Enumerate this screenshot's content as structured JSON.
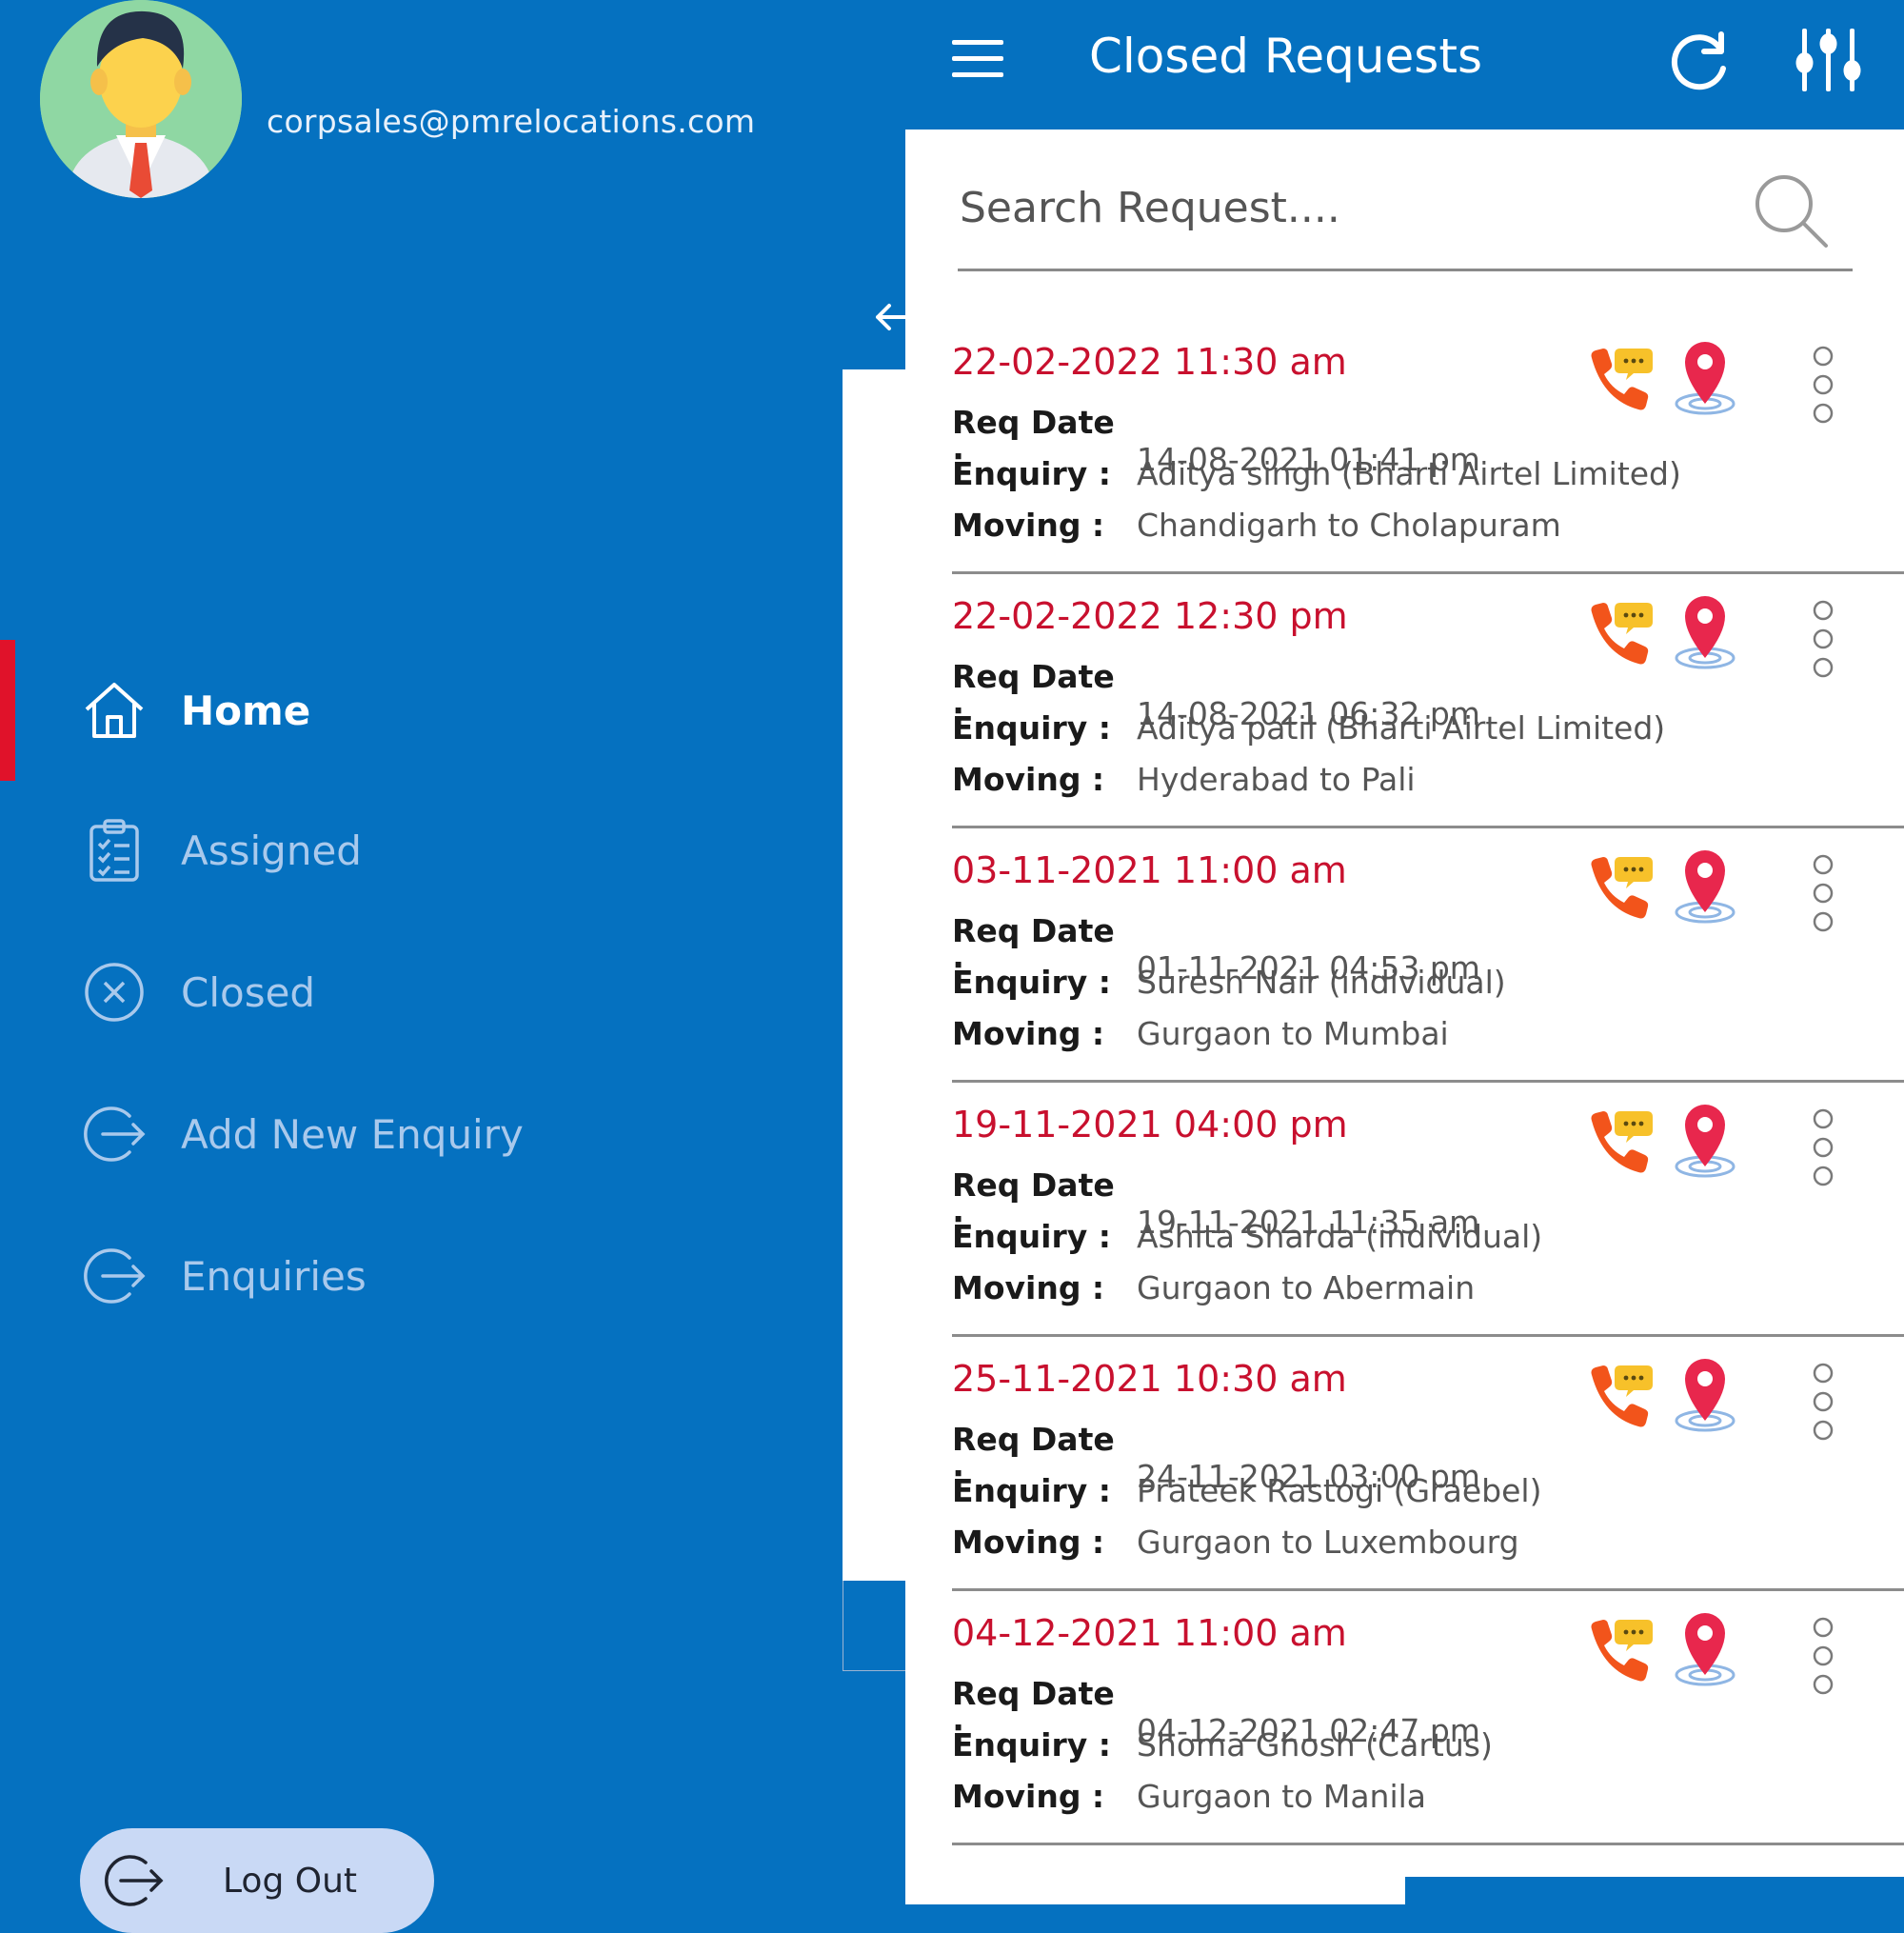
{
  "drawer": {
    "email": "corpsales@pmrelocations.com",
    "nav": [
      {
        "label": "Home",
        "icon": "home-icon",
        "active": true
      },
      {
        "label": "Assigned",
        "icon": "clipboard-icon",
        "active": false
      },
      {
        "label": "Closed",
        "icon": "close-circle-icon",
        "active": false
      },
      {
        "label": "Add New Enquiry",
        "icon": "login-arrow-icon",
        "active": false
      },
      {
        "label": "Enquiries",
        "icon": "login-arrow-icon",
        "active": false
      }
    ],
    "logout_label": "Log Out"
  },
  "header": {
    "title": "Closed Requests",
    "menu_icon": "hamburger-icon",
    "refresh_icon": "refresh-icon",
    "filter_icon": "filter-sliders-icon"
  },
  "search": {
    "placeholder": "Search Request...."
  },
  "labels": {
    "req_date": "Req Date :",
    "enquiry": "Enquiry :",
    "moving": "Moving :"
  },
  "requests": [
    {
      "date": "22-02-2022 11:30 am",
      "req_date": "14-08-2021 01:41 pm",
      "enquiry": "Aditya singh (Bharti Airtel Limited)",
      "moving": "Chandigarh to Cholapuram"
    },
    {
      "date": "22-02-2022 12:30 pm",
      "req_date": "14-08-2021 06:32 pm",
      "enquiry": "Aditya patil (Bharti Airtel Limited)",
      "moving": "Hyderabad to Pali"
    },
    {
      "date": "03-11-2021 11:00 am",
      "req_date": "01-11-2021 04:53 pm",
      "enquiry": "Suresh Nair (individual)",
      "moving": "Gurgaon to Mumbai"
    },
    {
      "date": "19-11-2021 04:00 pm",
      "req_date": "19-11-2021 11:35 am",
      "enquiry": "Ashita Sharda (individual)",
      "moving": "Gurgaon to Abermain"
    },
    {
      "date": "25-11-2021 10:30 am",
      "req_date": "24-11-2021 03:00 pm",
      "enquiry": "Prateek Rastogi (Graebel)",
      "moving": "Gurgaon to Luxembourg"
    },
    {
      "date": "04-12-2021 11:00 am",
      "req_date": "04-12-2021 02:47 pm",
      "enquiry": "Shoma  Ghosh  (Cartus)",
      "moving": "Gurgaon to Manila"
    }
  ],
  "colors": {
    "primary": "#0571c0",
    "date_red": "#c8102e",
    "active_marker": "#e0122a",
    "logout_bg": "#c9d9f5"
  }
}
